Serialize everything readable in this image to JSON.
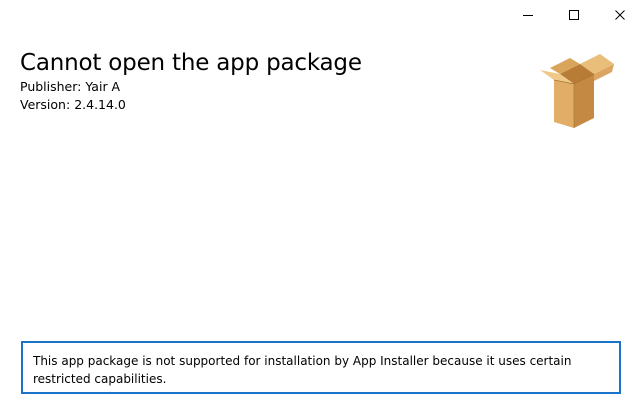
{
  "window": {
    "minimize_icon": "minimize-icon",
    "maximize_icon": "maximize-icon",
    "close_icon": "close-icon"
  },
  "app": {
    "title": "Cannot open the app package",
    "publisher_label": "Publisher:",
    "publisher_value": "Yair A",
    "version_label": "Version:",
    "version_value": "2.4.14.0",
    "package_icon": "package-box-icon"
  },
  "message": {
    "text": "This app package is not supported for installation by App Installer because it uses certain restricted capabilities."
  },
  "colors": {
    "accent": "#1a73c8",
    "box_light": "#e8b873",
    "box_dark": "#c98a3e"
  }
}
